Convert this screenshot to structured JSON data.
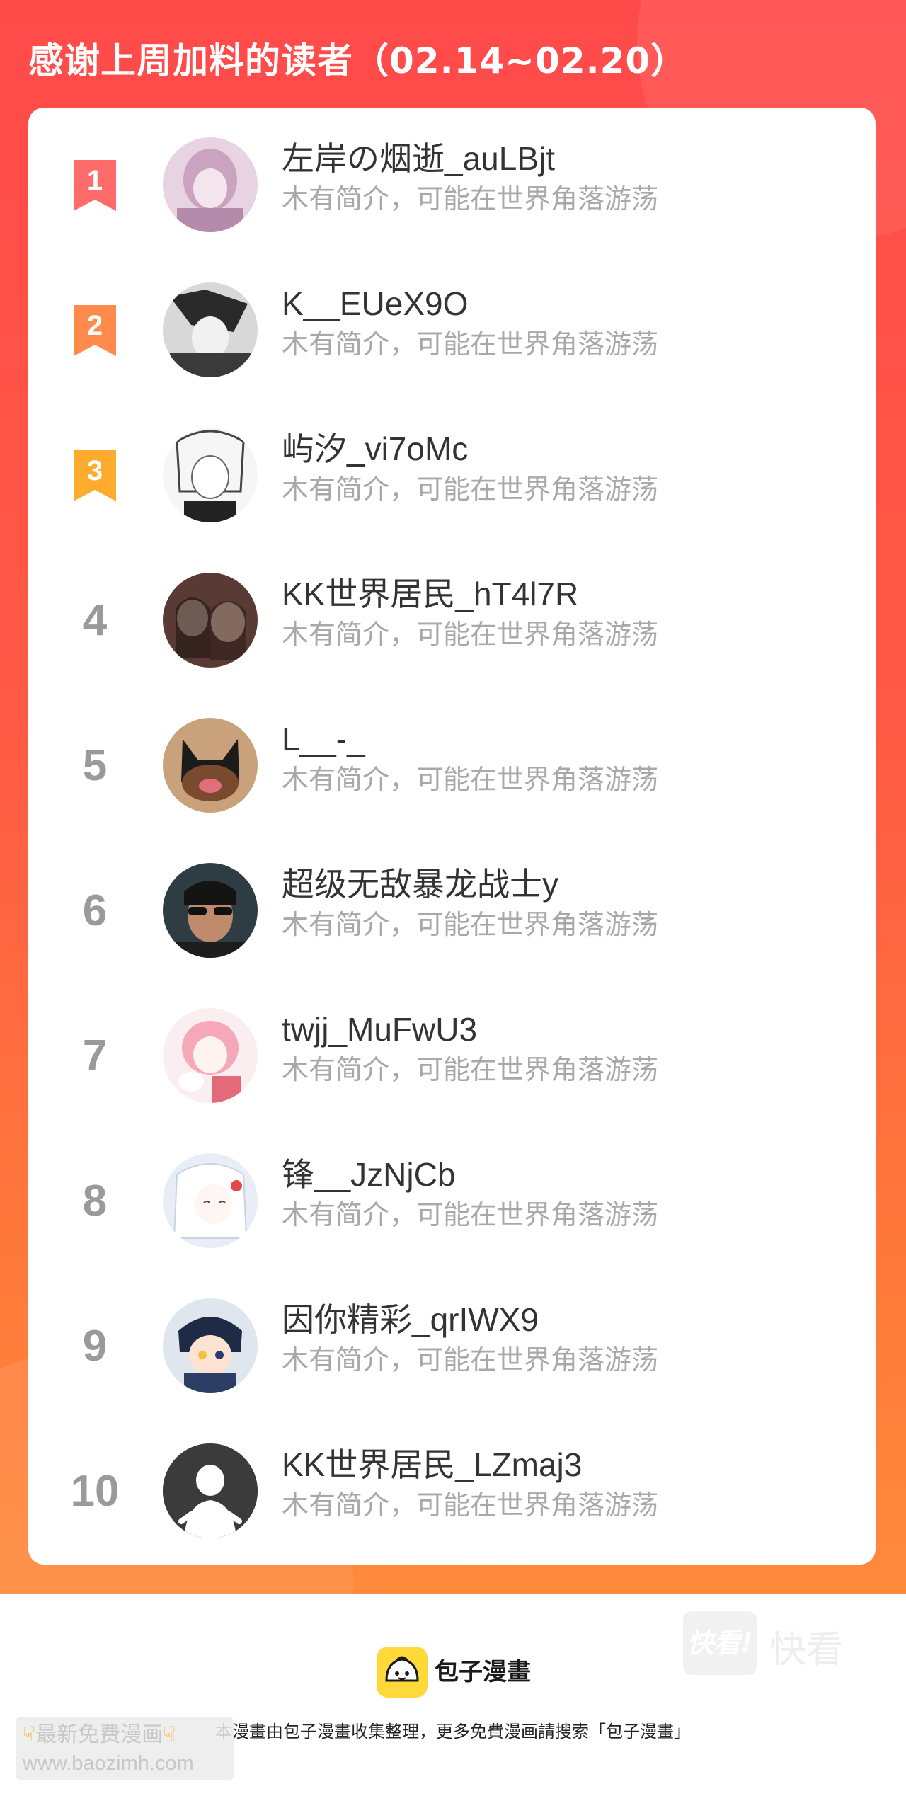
{
  "header": {
    "title": "感谢上周加料的读者（02.14~02.20）"
  },
  "colors": {
    "banner_top": "#ff4a4a",
    "banner_bottom": "#ff8a3c",
    "rank1": "#ff6b6b",
    "rank2": "#ff8a4c",
    "rank3": "#ffab2e",
    "rank_other": "#9a9a9a",
    "name": "#333333",
    "bio": "#a8a8a8"
  },
  "readers": [
    {
      "rank": "1",
      "name": "左岸の烟逝_auLBjt",
      "bio": "木有简介，可能在世界角落游荡",
      "avatar": "anime-girl-pink-avatar"
    },
    {
      "rank": "2",
      "name": "K__EUeX9O",
      "bio": "木有简介，可能在世界角落游荡",
      "avatar": "manga-boy-dark-avatar"
    },
    {
      "rank": "3",
      "name": "屿汐_vi7oMc",
      "bio": "木有简介，可能在世界角落游荡",
      "avatar": "manga-girl-sketch-avatar"
    },
    {
      "rank": "4",
      "name": "KK世界居民_hT4l7R",
      "bio": "木有简介，可能在世界角落游荡",
      "avatar": "two-women-photo-avatar"
    },
    {
      "rank": "5",
      "name": "L__-_",
      "bio": "木有简介，可能在世界角落游荡",
      "avatar": "dog-photo-avatar"
    },
    {
      "rank": "6",
      "name": "超级无敌暴龙战士y",
      "bio": "木有简介，可能在世界角落游荡",
      "avatar": "man-sunglasses-avatar"
    },
    {
      "rank": "7",
      "name": "twjj_MuFwU3",
      "bio": "木有简介，可能在世界角落游荡",
      "avatar": "pink-anime-girl-avatar"
    },
    {
      "rank": "8",
      "name": "锋__JzNjCb",
      "bio": "木有简介，可能在世界角落游荡",
      "avatar": "white-hair-anime-avatar"
    },
    {
      "rank": "9",
      "name": "因你精彩_qrIWX9",
      "bio": "木有简介，可能在世界角落游荡",
      "avatar": "chibi-boy-avatar"
    },
    {
      "rank": "10",
      "name": "KK世界居民_LZmaj3",
      "bio": "木有简介，可能在世界角落游荡",
      "avatar": "default-ghost-avatar"
    }
  ],
  "watermark": {
    "box_label": "快看!",
    "text": "快看"
  },
  "footer": {
    "logo_text": "包子漫畫",
    "note": "本漫畫由包子漫畫收集整理，更多免費漫画請搜索「包子漫畫」"
  },
  "corner_watermark": {
    "line1": "最新免费漫画",
    "line2": "www.baozimh.com"
  }
}
